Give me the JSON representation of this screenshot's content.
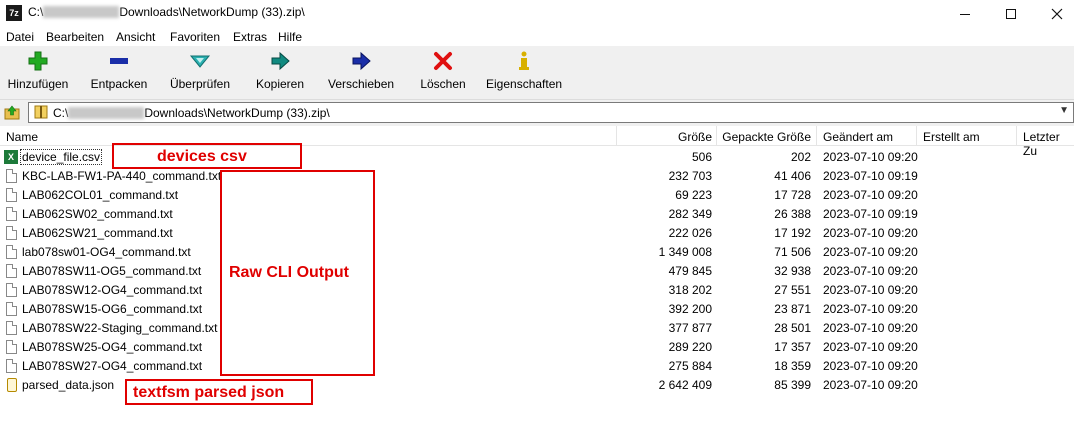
{
  "window": {
    "app_icon_text": "7z",
    "title_prefix": "C:\\",
    "title_suffix": "Downloads\\NetworkDump (33).zip\\",
    "minimize": "—",
    "maximize": "☐",
    "close": "✕"
  },
  "menu": [
    "Datei",
    "Bearbeiten",
    "Ansicht",
    "Favoriten",
    "Extras",
    "Hilfe"
  ],
  "toolbar": [
    {
      "label": "Hinzufügen",
      "icon": "add-icon",
      "color": "#22aa22"
    },
    {
      "label": "Entpacken",
      "icon": "extract-icon",
      "color": "#1a2ea8"
    },
    {
      "label": "Überprüfen",
      "icon": "test-icon",
      "color": "#20a0a0"
    },
    {
      "label": "Kopieren",
      "icon": "copy-icon",
      "color": "#108a80"
    },
    {
      "label": "Verschieben",
      "icon": "move-icon",
      "color": "#1a2ea8"
    },
    {
      "label": "Löschen",
      "icon": "delete-icon",
      "color": "#e01010"
    },
    {
      "label": "Eigenschaften",
      "icon": "info-icon",
      "color": "#d8b000"
    }
  ],
  "address": {
    "prefix": "C:\\",
    "suffix": "Downloads\\NetworkDump (33).zip\\"
  },
  "columns": {
    "name": "Name",
    "size": "Größe",
    "packed": "Gepackte Größe",
    "modified": "Geändert am",
    "created": "Erstellt am",
    "accessed": "Letzter Zu"
  },
  "files": [
    {
      "name": "device_file.csv",
      "size": "506",
      "packed": "202",
      "modified": "2023-07-10 09:20",
      "type": "csv"
    },
    {
      "name": "KBC-LAB-FW1-PA-440_command.txt",
      "size": "232 703",
      "packed": "41 406",
      "modified": "2023-07-10 09:19",
      "type": "txt"
    },
    {
      "name": "LAB062COL01_command.txt",
      "size": "69 223",
      "packed": "17 728",
      "modified": "2023-07-10 09:20",
      "type": "txt"
    },
    {
      "name": "LAB062SW02_command.txt",
      "size": "282 349",
      "packed": "26 388",
      "modified": "2023-07-10 09:19",
      "type": "txt"
    },
    {
      "name": "LAB062SW21_command.txt",
      "size": "222 026",
      "packed": "17 192",
      "modified": "2023-07-10 09:20",
      "type": "txt"
    },
    {
      "name": "lab078sw01-OG4_command.txt",
      "size": "1 349 008",
      "packed": "71 506",
      "modified": "2023-07-10 09:20",
      "type": "txt"
    },
    {
      "name": "LAB078SW11-OG5_command.txt",
      "size": "479 845",
      "packed": "32 938",
      "modified": "2023-07-10 09:20",
      "type": "txt"
    },
    {
      "name": "LAB078SW12-OG4_command.txt",
      "size": "318 202",
      "packed": "27 551",
      "modified": "2023-07-10 09:20",
      "type": "txt"
    },
    {
      "name": "LAB078SW15-OG6_command.txt",
      "size": "392 200",
      "packed": "23 871",
      "modified": "2023-07-10 09:20",
      "type": "txt"
    },
    {
      "name": "LAB078SW22-Staging_command.txt",
      "size": "377 877",
      "packed": "28 501",
      "modified": "2023-07-10 09:20",
      "type": "txt"
    },
    {
      "name": "LAB078SW25-OG4_command.txt",
      "size": "289 220",
      "packed": "17 357",
      "modified": "2023-07-10 09:20",
      "type": "txt"
    },
    {
      "name": "LAB078SW27-OG4_command.txt",
      "size": "275 884",
      "packed": "18 359",
      "modified": "2023-07-10 09:20",
      "type": "txt"
    },
    {
      "name": "parsed_data.json",
      "size": "2 642 409",
      "packed": "85 399",
      "modified": "2023-07-10 09:20",
      "type": "json"
    }
  ],
  "annotations": {
    "csv": "devices csv",
    "raw": "Raw CLI Output",
    "json": "textfsm parsed json",
    "color": "#e00000"
  }
}
